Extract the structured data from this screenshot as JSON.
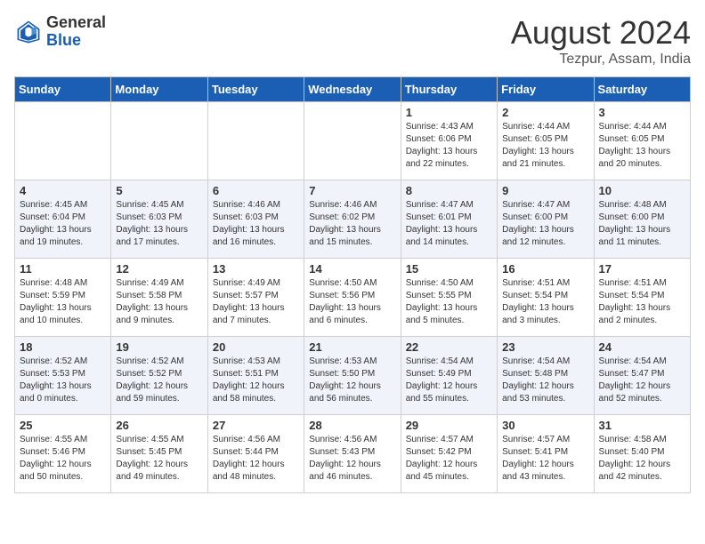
{
  "header": {
    "logo_general": "General",
    "logo_blue": "Blue",
    "month_year": "August 2024",
    "location": "Tezpur, Assam, India"
  },
  "days_of_week": [
    "Sunday",
    "Monday",
    "Tuesday",
    "Wednesday",
    "Thursday",
    "Friday",
    "Saturday"
  ],
  "weeks": [
    [
      {
        "day": "",
        "info": ""
      },
      {
        "day": "",
        "info": ""
      },
      {
        "day": "",
        "info": ""
      },
      {
        "day": "",
        "info": ""
      },
      {
        "day": "1",
        "info": "Sunrise: 4:43 AM\nSunset: 6:06 PM\nDaylight: 13 hours\nand 22 minutes."
      },
      {
        "day": "2",
        "info": "Sunrise: 4:44 AM\nSunset: 6:05 PM\nDaylight: 13 hours\nand 21 minutes."
      },
      {
        "day": "3",
        "info": "Sunrise: 4:44 AM\nSunset: 6:05 PM\nDaylight: 13 hours\nand 20 minutes."
      }
    ],
    [
      {
        "day": "4",
        "info": "Sunrise: 4:45 AM\nSunset: 6:04 PM\nDaylight: 13 hours\nand 19 minutes."
      },
      {
        "day": "5",
        "info": "Sunrise: 4:45 AM\nSunset: 6:03 PM\nDaylight: 13 hours\nand 17 minutes."
      },
      {
        "day": "6",
        "info": "Sunrise: 4:46 AM\nSunset: 6:03 PM\nDaylight: 13 hours\nand 16 minutes."
      },
      {
        "day": "7",
        "info": "Sunrise: 4:46 AM\nSunset: 6:02 PM\nDaylight: 13 hours\nand 15 minutes."
      },
      {
        "day": "8",
        "info": "Sunrise: 4:47 AM\nSunset: 6:01 PM\nDaylight: 13 hours\nand 14 minutes."
      },
      {
        "day": "9",
        "info": "Sunrise: 4:47 AM\nSunset: 6:00 PM\nDaylight: 13 hours\nand 12 minutes."
      },
      {
        "day": "10",
        "info": "Sunrise: 4:48 AM\nSunset: 6:00 PM\nDaylight: 13 hours\nand 11 minutes."
      }
    ],
    [
      {
        "day": "11",
        "info": "Sunrise: 4:48 AM\nSunset: 5:59 PM\nDaylight: 13 hours\nand 10 minutes."
      },
      {
        "day": "12",
        "info": "Sunrise: 4:49 AM\nSunset: 5:58 PM\nDaylight: 13 hours\nand 9 minutes."
      },
      {
        "day": "13",
        "info": "Sunrise: 4:49 AM\nSunset: 5:57 PM\nDaylight: 13 hours\nand 7 minutes."
      },
      {
        "day": "14",
        "info": "Sunrise: 4:50 AM\nSunset: 5:56 PM\nDaylight: 13 hours\nand 6 minutes."
      },
      {
        "day": "15",
        "info": "Sunrise: 4:50 AM\nSunset: 5:55 PM\nDaylight: 13 hours\nand 5 minutes."
      },
      {
        "day": "16",
        "info": "Sunrise: 4:51 AM\nSunset: 5:54 PM\nDaylight: 13 hours\nand 3 minutes."
      },
      {
        "day": "17",
        "info": "Sunrise: 4:51 AM\nSunset: 5:54 PM\nDaylight: 13 hours\nand 2 minutes."
      }
    ],
    [
      {
        "day": "18",
        "info": "Sunrise: 4:52 AM\nSunset: 5:53 PM\nDaylight: 13 hours\nand 0 minutes."
      },
      {
        "day": "19",
        "info": "Sunrise: 4:52 AM\nSunset: 5:52 PM\nDaylight: 12 hours\nand 59 minutes."
      },
      {
        "day": "20",
        "info": "Sunrise: 4:53 AM\nSunset: 5:51 PM\nDaylight: 12 hours\nand 58 minutes."
      },
      {
        "day": "21",
        "info": "Sunrise: 4:53 AM\nSunset: 5:50 PM\nDaylight: 12 hours\nand 56 minutes."
      },
      {
        "day": "22",
        "info": "Sunrise: 4:54 AM\nSunset: 5:49 PM\nDaylight: 12 hours\nand 55 minutes."
      },
      {
        "day": "23",
        "info": "Sunrise: 4:54 AM\nSunset: 5:48 PM\nDaylight: 12 hours\nand 53 minutes."
      },
      {
        "day": "24",
        "info": "Sunrise: 4:54 AM\nSunset: 5:47 PM\nDaylight: 12 hours\nand 52 minutes."
      }
    ],
    [
      {
        "day": "25",
        "info": "Sunrise: 4:55 AM\nSunset: 5:46 PM\nDaylight: 12 hours\nand 50 minutes."
      },
      {
        "day": "26",
        "info": "Sunrise: 4:55 AM\nSunset: 5:45 PM\nDaylight: 12 hours\nand 49 minutes."
      },
      {
        "day": "27",
        "info": "Sunrise: 4:56 AM\nSunset: 5:44 PM\nDaylight: 12 hours\nand 48 minutes."
      },
      {
        "day": "28",
        "info": "Sunrise: 4:56 AM\nSunset: 5:43 PM\nDaylight: 12 hours\nand 46 minutes."
      },
      {
        "day": "29",
        "info": "Sunrise: 4:57 AM\nSunset: 5:42 PM\nDaylight: 12 hours\nand 45 minutes."
      },
      {
        "day": "30",
        "info": "Sunrise: 4:57 AM\nSunset: 5:41 PM\nDaylight: 12 hours\nand 43 minutes."
      },
      {
        "day": "31",
        "info": "Sunrise: 4:58 AM\nSunset: 5:40 PM\nDaylight: 12 hours\nand 42 minutes."
      }
    ]
  ]
}
